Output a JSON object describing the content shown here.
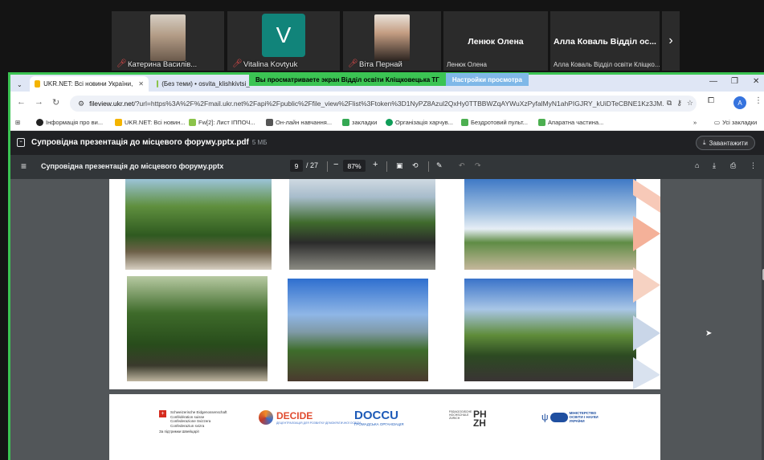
{
  "participants": [
    {
      "name": "Катерина Василів...",
      "muted": true
    },
    {
      "name": "Vitalina Kovtyuk",
      "muted": true,
      "initial": "V"
    },
    {
      "name": "Віта Пернай",
      "muted": true
    },
    {
      "name": "Ленюк Олена",
      "label": "Ленюк Олена"
    },
    {
      "name": "Алла Коваль Відділ ос...",
      "label": "Алла Коваль Відділ освіти Кліщко..."
    }
  ],
  "share_banner": {
    "text": "Вы просматриваете экран  Відділ освіти Кліщковецька ТГ",
    "settings": "Настройки просмотра"
  },
  "browser": {
    "tabs": [
      {
        "title": "UKR.NET: Всі новини України,",
        "active": true
      },
      {
        "title": "(Без теми) • osvita_klishkivtsi_t",
        "active": false
      }
    ],
    "url_host": "fileview.ukr.net",
    "url_rest": "/?url=https%3A%2F%2Fmail.ukr.net%2Fapi%2Fpublic%2Ffile_view%2Flist%3Ftoken%3D1NyPZ8Azul2QxHy0TTBBWZqAYWuXzPyfalMyN1ahPIGJRY_kUiDTeCBNE1Kz3JM...",
    "bookmarks": [
      "Інформація про ви...",
      "UKR.NET: Всі новин...",
      "Fw[2]: Лист ІППОЧ...",
      "Он-лайн навчання...",
      "закладки",
      "Організація харчув...",
      "Бездротовий пульт...",
      "Апаратна частина..."
    ],
    "bookmarks_more": "»",
    "all_bookmarks": "Усі закладки",
    "profile_initial": "A"
  },
  "pdf": {
    "file_title": "Супровідна презентація до місцевого форуму.pptx.pdf",
    "file_size": "5 МБ",
    "download_label": "Завантажити",
    "doc_name": "Супровідна презентація до місцевого форуму.pptx",
    "page_current": "9",
    "page_total": "/ 27",
    "zoom": "87%"
  },
  "logos": {
    "swiss": [
      "Schweizerische Eidgenossenschaft",
      "Confédération suisse",
      "Confederazione Svizzera",
      "Confederaziun svizra",
      "За підтримки Швейцарії"
    ],
    "decide": "DECIDE",
    "decide_sub": "ДЕЦЕНТРАЛІЗАЦІЯ ДЛЯ РОЗВИТКУ ДЕМОКРАТИЧНОЇ ОСВІТИ",
    "docu": "DOCCU",
    "docu_sub": "ГРОМАДСЬКА ОРГАНІЗАЦІЯ",
    "phzh_small": "PÄDAGOGISCHE HOCHSCHULE ZÜRICH",
    "phzh": "PH ZH",
    "mon": "МІНІСТЕРСТВО ОСВІТИ І НАУКИ УКРАЇНИ"
  }
}
